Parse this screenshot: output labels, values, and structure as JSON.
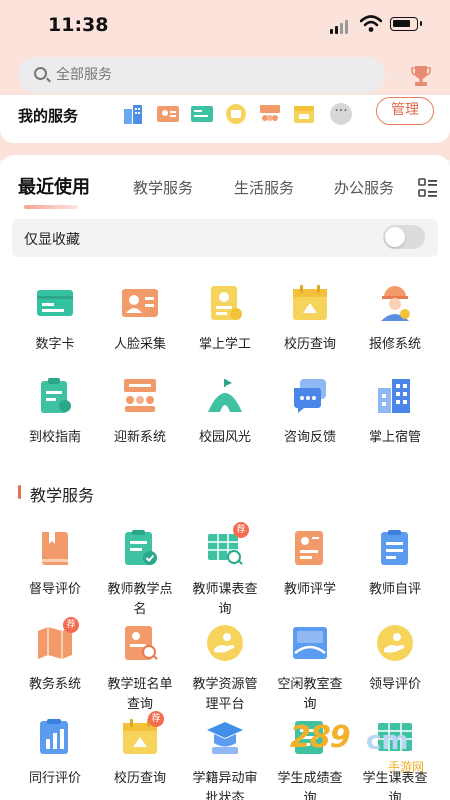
{
  "status": {
    "time": "11:38"
  },
  "search": {
    "placeholder": "全部服务"
  },
  "my_services": {
    "label": "我的服务",
    "manage": "管理",
    "more": "···"
  },
  "tabs": [
    "最近使用",
    "教学服务",
    "生活服务",
    "办公服务"
  ],
  "favorites": {
    "label": "仅显收藏",
    "on": false
  },
  "recent": [
    {
      "label": "数字卡",
      "icon": "id-card-icon"
    },
    {
      "label": "人脸采集",
      "icon": "face-capture-icon"
    },
    {
      "label": "掌上学工",
      "icon": "student-work-icon"
    },
    {
      "label": "校历查询",
      "icon": "calendar-icon"
    },
    {
      "label": "报修系统",
      "icon": "repair-worker-icon"
    },
    {
      "label": "到校指南",
      "icon": "guide-clipboard-icon"
    },
    {
      "label": "迎新系统",
      "icon": "welcome-group-icon"
    },
    {
      "label": "校园风光",
      "icon": "campus-tent-icon"
    },
    {
      "label": "咨询反馈",
      "icon": "chat-bubble-icon"
    },
    {
      "label": "掌上宿管",
      "icon": "dormitory-building-icon"
    }
  ],
  "teaching_section": {
    "title": "教学服务"
  },
  "teaching": [
    {
      "label": "督导评价",
      "icon": "book-icon"
    },
    {
      "label": "教师教学点名",
      "icon": "roll-call-icon"
    },
    {
      "label": "教师课表查询",
      "icon": "timetable-search-icon",
      "badge": "荐"
    },
    {
      "label": "教师评学",
      "icon": "evaluation-icon"
    },
    {
      "label": "教师自评",
      "icon": "self-evaluation-icon"
    },
    {
      "label": "教务系统",
      "icon": "academic-map-icon",
      "badge": "荐"
    },
    {
      "label": "教学班名单查询",
      "icon": "class-list-icon"
    },
    {
      "label": "教学资源管理平台",
      "icon": "resource-hand-icon"
    },
    {
      "label": "空闲教室查询",
      "icon": "classroom-icon"
    },
    {
      "label": "领导评价",
      "icon": "leader-hand-icon"
    },
    {
      "label": "同行评价",
      "icon": "peer-chart-icon"
    },
    {
      "label": "校历查询",
      "icon": "calendar-icon",
      "badge": "荐"
    },
    {
      "label": "学籍异动审批状态",
      "icon": "graduation-cap-icon"
    },
    {
      "label": "学生成绩查询",
      "icon": "grades-icon"
    },
    {
      "label": "学生课表查询",
      "icon": "student-timetable-icon"
    }
  ],
  "watermark": {
    "brand": "289",
    "suffix": "cm",
    "sub": "手游网"
  }
}
